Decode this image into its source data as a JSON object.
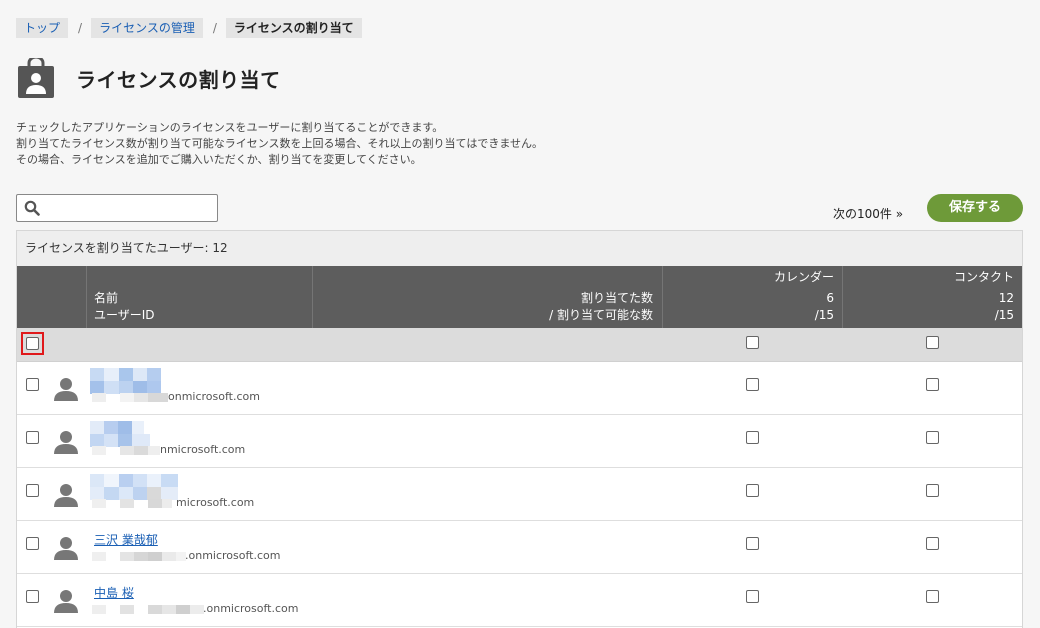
{
  "breadcrumb": {
    "top": "トップ",
    "license_manage": "ライセンスの管理",
    "current": "ライセンスの割り当て"
  },
  "page": {
    "title": "ライセンスの割り当て",
    "desc_line1": "チェックしたアプリケーションのライセンスをユーザーに割り当てることができます。",
    "desc_line2": "割り当てたライセンス数が割り当て可能なライセンス数を上回る場合、それ以上の割り当てはできません。",
    "desc_line3": "その場合、ライセンスを追加でご購入いただくか、割り当てを変更してください。"
  },
  "search": {
    "value": "",
    "placeholder": ""
  },
  "next_link": "次の100件 »",
  "save_label": "保存する",
  "summary": "ライセンスを割り当てたユーザー: 12",
  "header": {
    "name": "名前",
    "user_id": "ユーザーID",
    "assigned": "割り当てた数",
    "assignable": "/ 割り当て可能な数",
    "calendar": {
      "label": "カレンダー",
      "count": "6",
      "total": "/15"
    },
    "contact": {
      "label": "コンタクト",
      "count": "12",
      "total": "/15"
    }
  },
  "rows": [
    {
      "name": "",
      "domain": "onmicrosoft.com"
    },
    {
      "name": "",
      "domain": "nmicrosoft.com"
    },
    {
      "name": "",
      "domain": "microsoft.com"
    },
    {
      "name": "三沢 業哉郁",
      "domain": ".onmicrosoft.com"
    },
    {
      "name": "中島 桜",
      "domain": ".onmicrosoft.com"
    }
  ],
  "colors": {
    "accent_green": "#6e9a39",
    "header_dark": "#5d5d5d",
    "link_blue": "#1a5fb4",
    "highlight_red": "#e0191b"
  },
  "icons": {
    "title": "license-bag-icon",
    "search": "search-icon",
    "user": "user-icon"
  }
}
